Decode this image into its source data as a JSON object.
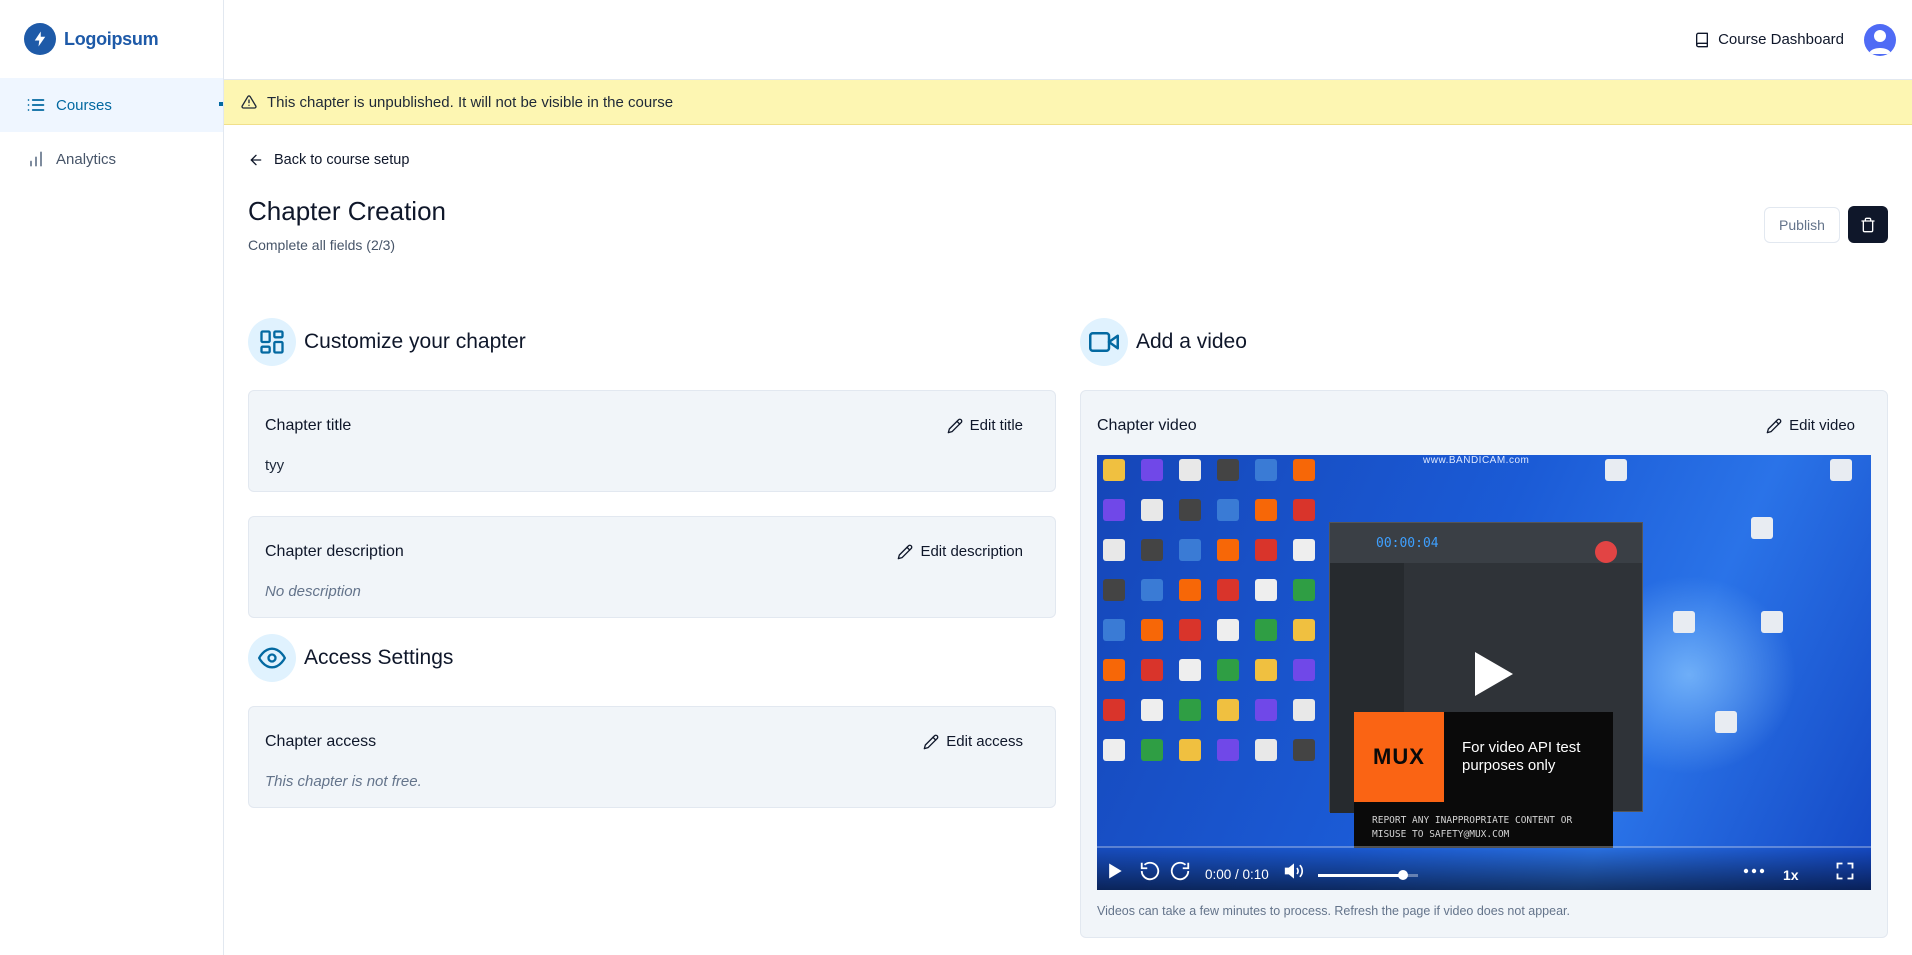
{
  "brand": {
    "name": "Logoipsum",
    "color": "#1e5aa8"
  },
  "sidebar": {
    "items": [
      {
        "label": "Courses",
        "icon": "list-icon",
        "active": true
      },
      {
        "label": "Analytics",
        "icon": "bar-chart-icon",
        "active": false
      }
    ]
  },
  "header": {
    "dashboard_label": "Course Dashboard",
    "avatar_icon": "user-avatar-icon"
  },
  "banner": {
    "text": "This chapter is unpublished. It will not be visible in the course",
    "icon": "alert-triangle-icon",
    "color": "#fdf6b2"
  },
  "page": {
    "back_label": "Back to course setup",
    "title": "Chapter Creation",
    "subtitle": "Complete all fields (2/3)",
    "publish_label": "Publish",
    "delete_icon": "trash-icon"
  },
  "customize": {
    "section_title": "Customize your chapter",
    "icon": "layout-dashboard-icon",
    "title_card": {
      "label": "Chapter title",
      "action": "Edit title",
      "value": "tyy"
    },
    "description_card": {
      "label": "Chapter description",
      "action": "Edit description",
      "value": "No description"
    }
  },
  "access": {
    "section_title": "Access Settings",
    "icon": "eye-icon",
    "card": {
      "label": "Chapter access",
      "action": "Edit access",
      "value": "This chapter is not free."
    }
  },
  "video": {
    "section_title": "Add a video",
    "icon": "video-icon",
    "card_label": "Chapter video",
    "action": "Edit video",
    "watermark": "www.BANDICAM.com",
    "recorder_timer": "00:00:04",
    "mux_logo": "MUX",
    "mux_text": "For video API test purposes only",
    "mux_report": "REPORT ANY INAPPROPRIATE CONTENT OR MISUSE TO SAFETY@MUX.COM",
    "time": "0:00 / 0:10",
    "volume": 0.85,
    "playback_rate": "1x",
    "note": "Videos can take a few minutes to process. Refresh the page if video does not appear."
  }
}
